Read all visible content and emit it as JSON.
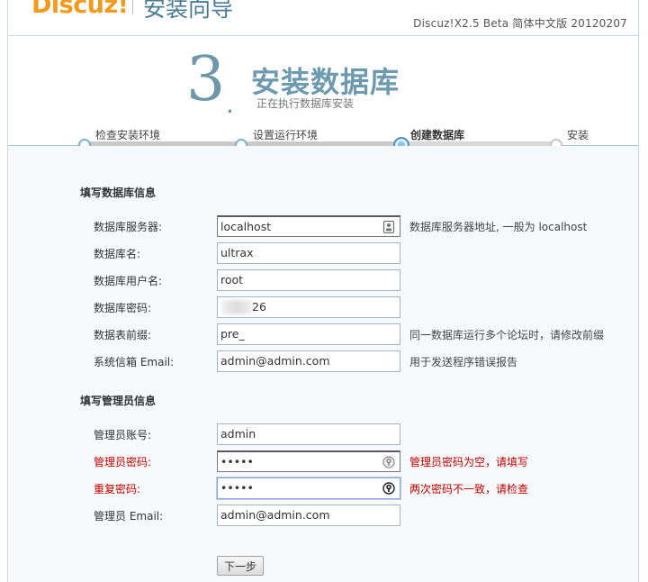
{
  "header": {
    "logo": "Discuz!",
    "title": "安装向导",
    "version": "Discuz!X2.5 Beta 简体中文版 20120207"
  },
  "step": {
    "number": "3",
    "title": "安装数据库",
    "subtitle": "正在执行数据库安装"
  },
  "progress": {
    "steps": [
      {
        "label": "检查安装环境",
        "state": "done"
      },
      {
        "label": "设置运行环境",
        "state": "done"
      },
      {
        "label": "创建数据库",
        "state": "active"
      },
      {
        "label": "安装",
        "state": "todo"
      }
    ]
  },
  "db_section": {
    "title": "填写数据库信息",
    "rows": [
      {
        "label": "数据库服务器:",
        "value": "localhost",
        "hint": "数据库服务器地址, 一般为 localhost"
      },
      {
        "label": "数据库名:",
        "value": "ultrax",
        "hint": ""
      },
      {
        "label": "数据库用户名:",
        "value": "root",
        "hint": ""
      },
      {
        "label": "数据库密码:",
        "value": "26",
        "hint": ""
      },
      {
        "label": "数据表前缀:",
        "value": "pre_",
        "hint": "同一数据库运行多个论坛时，请修改前缀"
      },
      {
        "label": "系统信箱 Email:",
        "value": "admin@admin.com",
        "hint": "用于发送程序错误报告"
      }
    ]
  },
  "admin_section": {
    "title": "填写管理员信息",
    "rows": [
      {
        "label": "管理员账号:",
        "value": "admin",
        "hint": ""
      },
      {
        "label": "管理员密码:",
        "value": "•••••",
        "hint": "管理员密码为空，请填写"
      },
      {
        "label": "重复密码:",
        "value": "•••••",
        "hint": "两次密码不一致，请检查"
      },
      {
        "label": "管理员 Email:",
        "value": "admin@admin.com",
        "hint": ""
      }
    ]
  },
  "next_button": "下一步",
  "colors": {
    "logo": "#f29a1b",
    "accent": "#6d9aae",
    "error": "#c40000"
  },
  "icons": {
    "server_field": "id-card-icon",
    "password_field": "key-icon"
  }
}
